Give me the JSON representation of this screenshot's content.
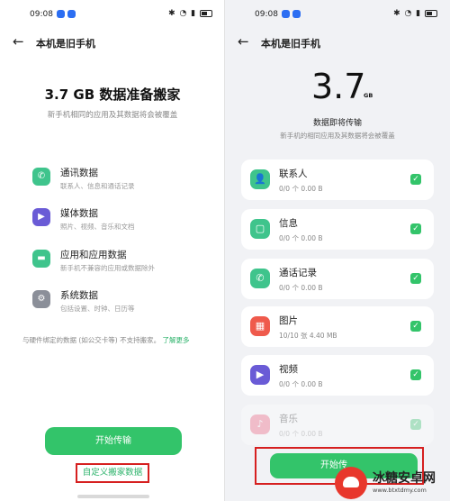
{
  "left": {
    "status": {
      "time": "09:08"
    },
    "nav_title": "本机是旧手机",
    "headline": "3.7 GB 数据准备搬家",
    "subtitle": "新手机相同的应用及其数据将会被覆盖",
    "items": [
      {
        "title": "通讯数据",
        "desc": "联系人、信息和通话记录",
        "icon": "phone-icon",
        "color": "#3fc48c"
      },
      {
        "title": "媒体数据",
        "desc": "照片、视频、音乐和文档",
        "icon": "play-icon",
        "color": "#6a5bd6"
      },
      {
        "title": "应用和应用数据",
        "desc": "新手机不兼容的应用或数据除外",
        "icon": "android-icon",
        "color": "#3fc48c"
      },
      {
        "title": "系统数据",
        "desc": "包括设置、时钟、日历等",
        "icon": "settings-icon",
        "color": "#8b8f99"
      }
    ],
    "note": "与硬件绑定的数据 (如公交卡等) 不支持搬家。",
    "note_link": "了解更多",
    "start_button": "开始传输",
    "custom_link": "自定义搬家数据"
  },
  "right": {
    "status": {
      "time": "09:08"
    },
    "nav_title": "本机是旧手机",
    "size_value": "3.7",
    "size_unit": "GB",
    "title": "数据即将传输",
    "subtitle": "新手机的相同应用及其数据将会被覆盖",
    "items": [
      {
        "name": "联系人",
        "info": "0/0 个   0.00 B",
        "icon": "contact-icon",
        "color": "#3fc48c"
      },
      {
        "name": "信息",
        "info": "0/0 个   0.00 B",
        "icon": "message-icon",
        "color": "#3fc48c"
      },
      {
        "name": "通话记录",
        "info": "0/0 个   0.00 B",
        "icon": "phone-icon",
        "color": "#3fc48c"
      },
      {
        "name": "图片",
        "info": "10/10 张   4.40 MB",
        "icon": "image-icon",
        "color": "#ef5a4c"
      },
      {
        "name": "视频",
        "info": "0/0 个   0.00 B",
        "icon": "play-icon",
        "color": "#6a5bd6"
      },
      {
        "name": "音乐",
        "info": "0/0 个   0.00 B",
        "icon": "music-icon",
        "color": "#ef5a7a"
      }
    ],
    "start_button": "开始传"
  },
  "watermark": {
    "name": "冰糖安卓网",
    "url": "www.btxtdmy.com"
  }
}
